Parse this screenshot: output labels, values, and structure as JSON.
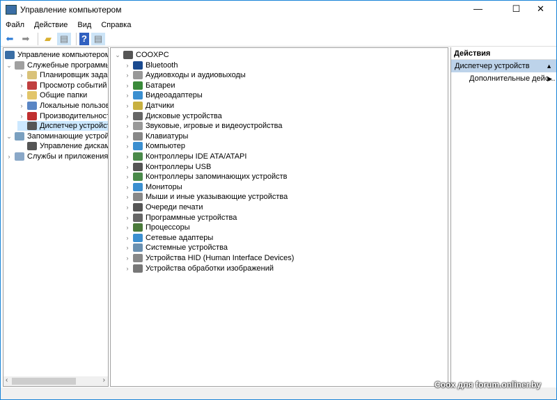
{
  "window": {
    "title": "Управление компьютером",
    "minimize": "—",
    "maximize": "☐",
    "close": "✕"
  },
  "menu": [
    "Файл",
    "Действие",
    "Вид",
    "Справка"
  ],
  "toolbar": {
    "icons": [
      "back-icon",
      "forward-icon",
      "up-folder-icon",
      "show-hide-tree-icon",
      "help-icon",
      "show-hide-action-pane-icon"
    ]
  },
  "tree": [
    {
      "label": "Управление компьютером (локальным)",
      "level": 0,
      "chev": "",
      "color": "#3a6ea5"
    },
    {
      "label": "Служебные программы",
      "level": 1,
      "chev": "v",
      "color": "#a0a0a0"
    },
    {
      "label": "Планировщик заданий",
      "level": 2,
      "chev": ">",
      "color": "#d9c27a"
    },
    {
      "label": "Просмотр событий",
      "level": 2,
      "chev": ">",
      "color": "#c04040"
    },
    {
      "label": "Общие папки",
      "level": 2,
      "chev": ">",
      "color": "#e2c56a"
    },
    {
      "label": "Локальные пользователи и группы",
      "level": 2,
      "chev": ">",
      "color": "#5a86c5"
    },
    {
      "label": "Производительность",
      "level": 2,
      "chev": ">",
      "color": "#c03030"
    },
    {
      "label": "Диспетчер устройств",
      "level": 2,
      "chev": "",
      "color": "#555",
      "selected": true
    },
    {
      "label": "Запоминающие устройства",
      "level": 1,
      "chev": "v",
      "color": "#7aa0c0"
    },
    {
      "label": "Управление дисками",
      "level": 2,
      "chev": "",
      "color": "#555"
    },
    {
      "label": "Службы и приложения",
      "level": 1,
      "chev": ">",
      "color": "#8aa8c8"
    }
  ],
  "devices": {
    "root": "COOXPC",
    "items": [
      "Bluetooth",
      "Аудиовходы и аудиовыходы",
      "Батареи",
      "Видеоадаптеры",
      "Датчики",
      "Дисковые устройства",
      "Звуковые, игровые и видеоустройства",
      "Клавиатуры",
      "Компьютер",
      "Контроллеры IDE ATA/ATAPI",
      "Контроллеры USB",
      "Контроллеры запоминающих устройств",
      "Мониторы",
      "Мыши и иные указывающие устройства",
      "Очереди печати",
      "Программные устройства",
      "Процессоры",
      "Сетевые адаптеры",
      "Системные устройства",
      "Устройства HID (Human Interface Devices)",
      "Устройства обработки изображений"
    ]
  },
  "actions": {
    "header": "Действия",
    "section": "Диспетчер устройств",
    "item": "Дополнительные дейс..."
  },
  "watermark": "Coox для forum.onliner.by"
}
